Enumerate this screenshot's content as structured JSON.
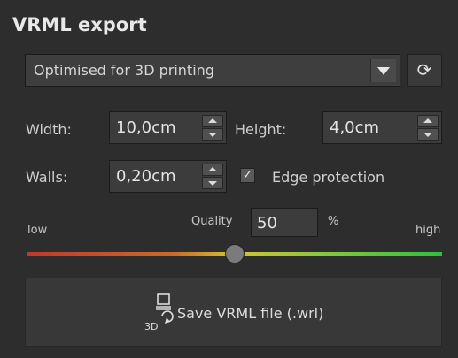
{
  "panel": {
    "title": "VRML export"
  },
  "preset": {
    "value": "Optimised for 3D printing"
  },
  "dimensions": {
    "width_label": "Width:",
    "width_value": "10,0cm",
    "height_label": "Height:",
    "height_value": "4,0cm",
    "walls_label": "Walls:",
    "walls_value": "0,20cm",
    "edge_label": "Edge protection",
    "edge_checked": true
  },
  "quality": {
    "low_label": "low",
    "label": "Quality",
    "value": "50",
    "unit": "%",
    "high_label": "high",
    "slider_fraction": 0.5
  },
  "save": {
    "label": "Save VRML file (.wrl)",
    "icon_text": "3D"
  },
  "icons": {
    "reset": "refresh-icon",
    "save": "save-3d-icon"
  }
}
